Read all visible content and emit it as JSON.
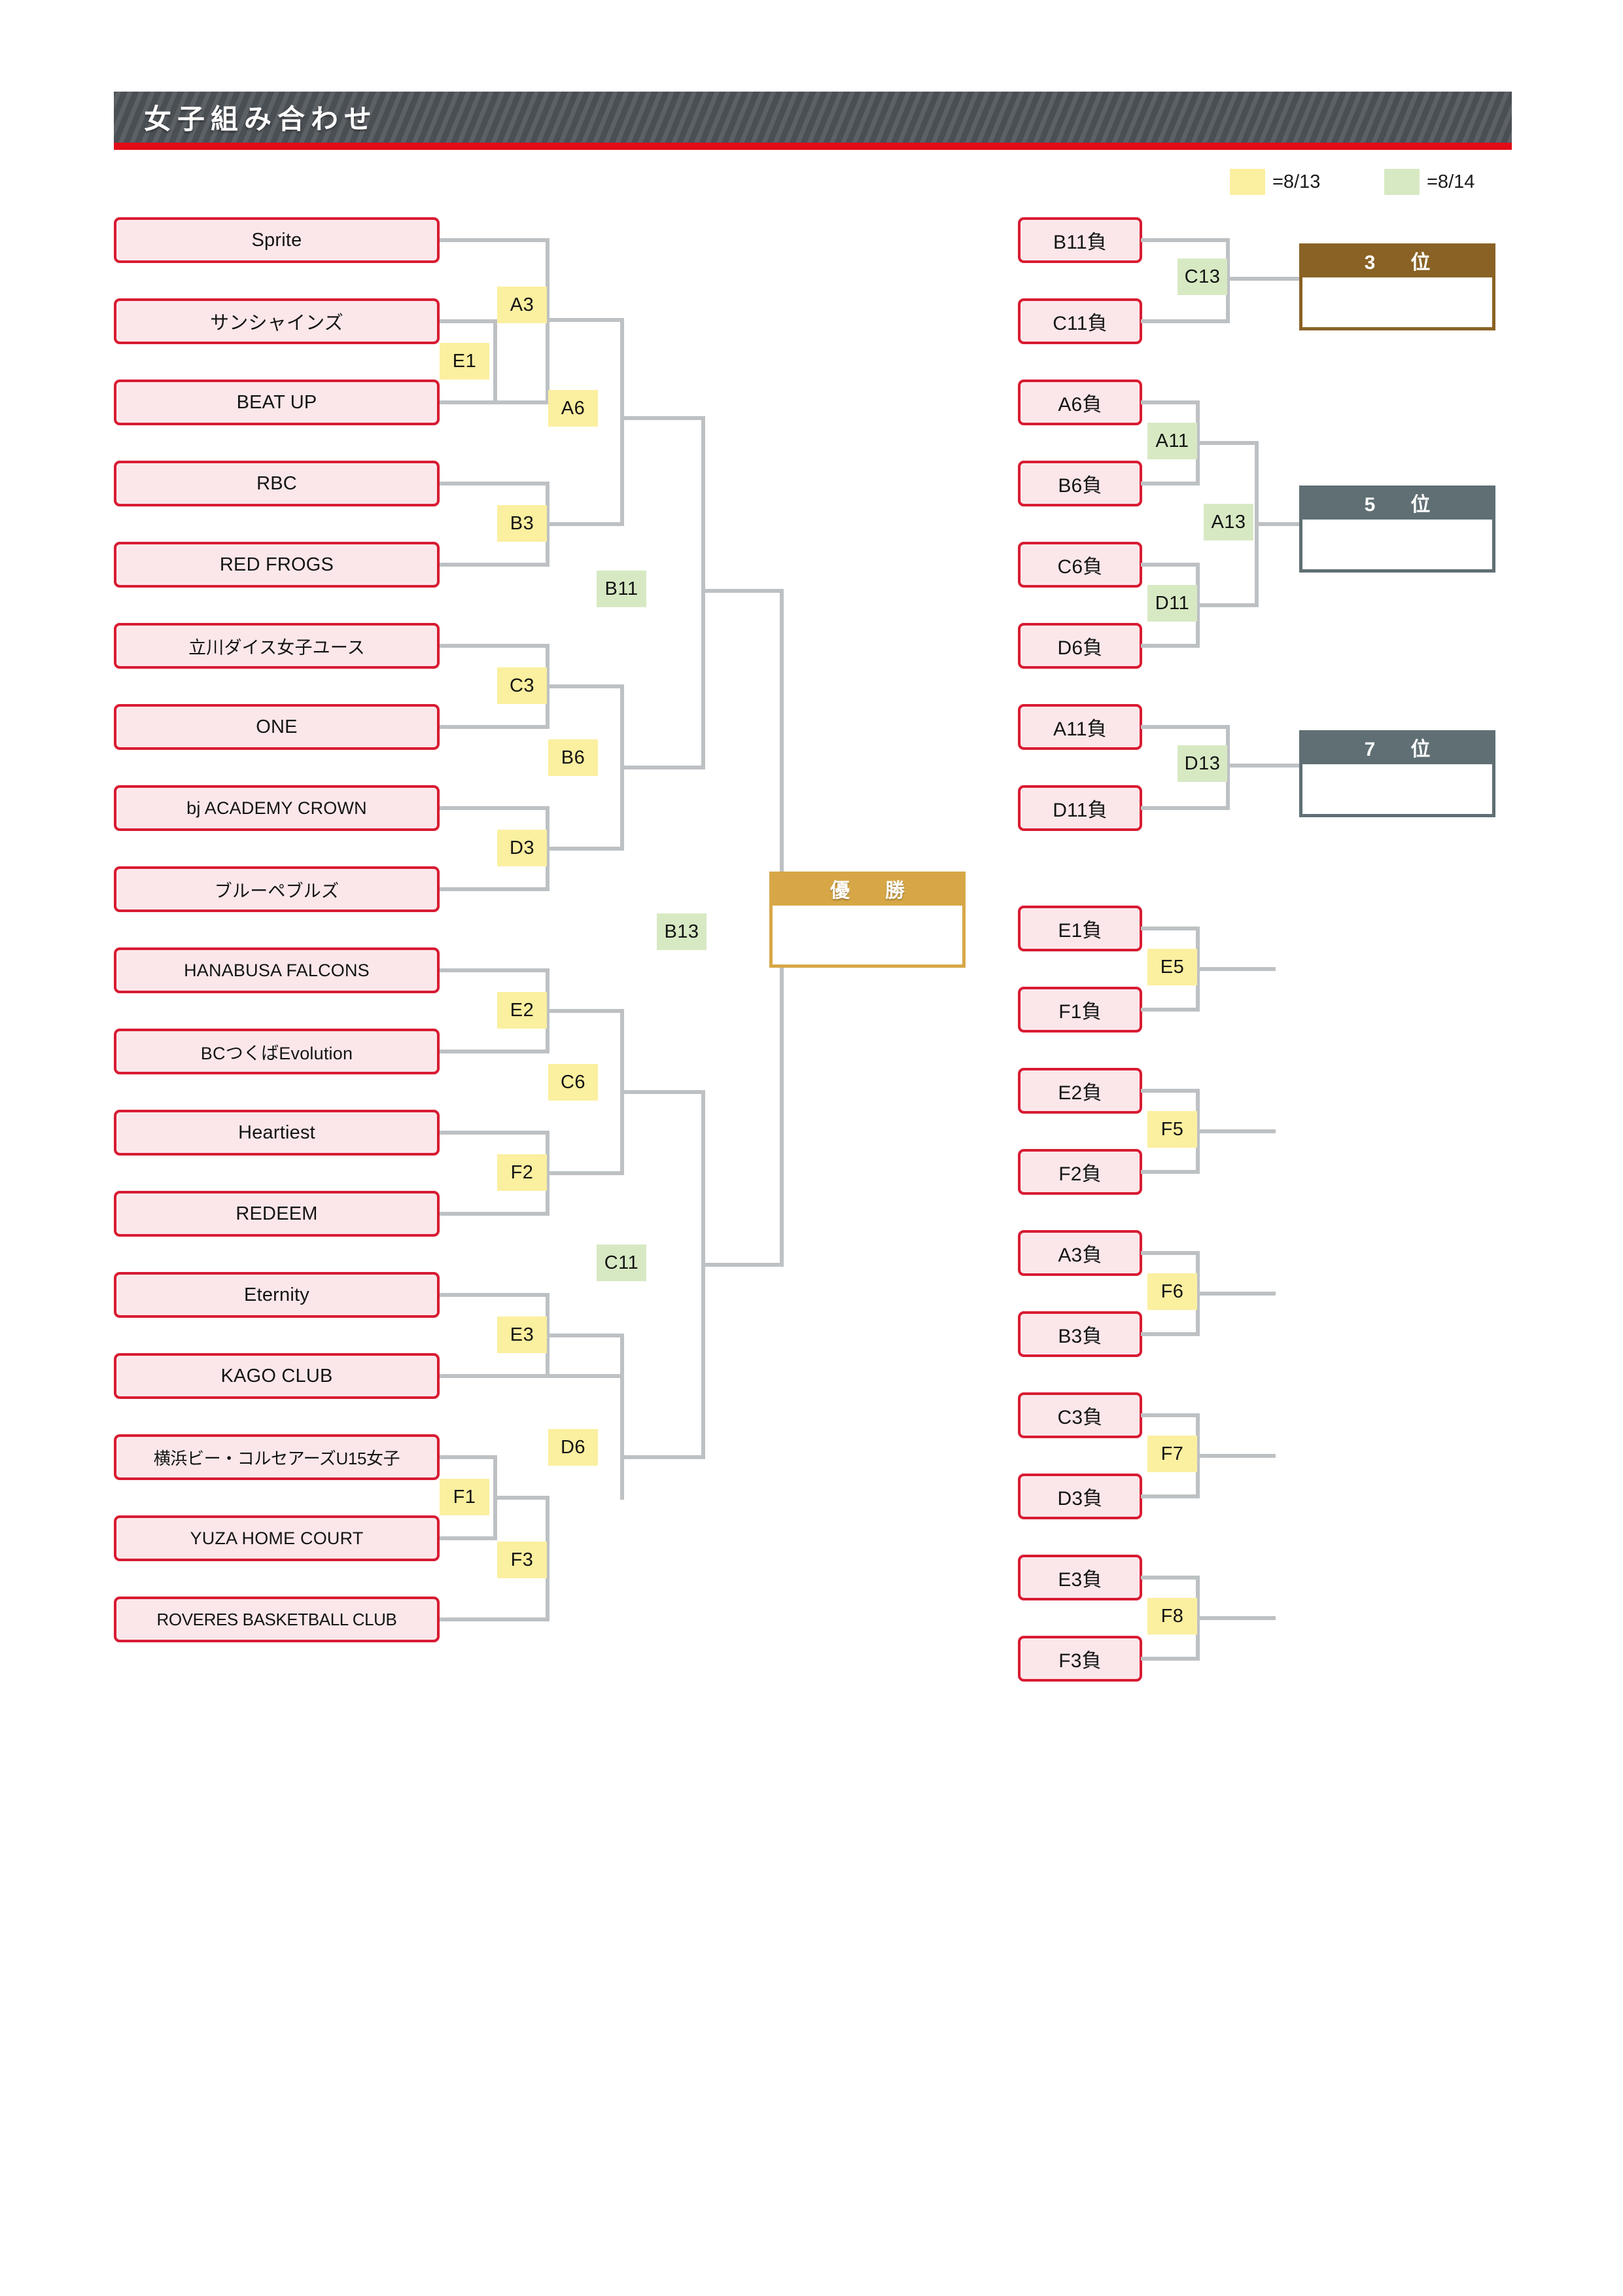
{
  "header": {
    "title": "女子組み合わせ",
    "accent_color": "#e30b18",
    "bar_color": "#4a4f54"
  },
  "legend": {
    "items": [
      {
        "swatch_color": "#fbefa0",
        "label": "=8/13"
      },
      {
        "swatch_color": "#d7e9c3",
        "label": "=8/14"
      }
    ]
  },
  "main_bracket": {
    "teams": [
      {
        "name": "Sprite"
      },
      {
        "name": "サンシャインズ"
      },
      {
        "name": "BEAT UP"
      },
      {
        "name": "RBC"
      },
      {
        "name": "RED FROGS"
      },
      {
        "name": "立川ダイス女子ユース"
      },
      {
        "name": "ONE"
      },
      {
        "name": "bj ACADEMY CROWN"
      },
      {
        "name": "ブルーペブルズ"
      },
      {
        "name": "HANABUSA FALCONS"
      },
      {
        "name": "BCつくばEvolution"
      },
      {
        "name": "Heartiest"
      },
      {
        "name": "REDEEM"
      },
      {
        "name": "Eternity"
      },
      {
        "name": "KAGO CLUB"
      },
      {
        "name": "横浜ビー・コルセアーズU15女子"
      },
      {
        "name": "YUZA HOME COURT"
      },
      {
        "name": "ROVERES BASKETBALL CLUB"
      }
    ],
    "matches": [
      {
        "code": "A3",
        "day": "8/13"
      },
      {
        "code": "E1",
        "day": "8/13"
      },
      {
        "code": "A6",
        "day": "8/13"
      },
      {
        "code": "B3",
        "day": "8/13"
      },
      {
        "code": "B11",
        "day": "8/14"
      },
      {
        "code": "C3",
        "day": "8/13"
      },
      {
        "code": "B6",
        "day": "8/13"
      },
      {
        "code": "D3",
        "day": "8/13"
      },
      {
        "code": "B13",
        "day": "8/14"
      },
      {
        "code": "E2",
        "day": "8/13"
      },
      {
        "code": "C6",
        "day": "8/13"
      },
      {
        "code": "F2",
        "day": "8/13"
      },
      {
        "code": "C11",
        "day": "8/14"
      },
      {
        "code": "E3",
        "day": "8/13"
      },
      {
        "code": "D6",
        "day": "8/13"
      },
      {
        "code": "F1",
        "day": "8/13"
      },
      {
        "code": "F3",
        "day": "8/13"
      }
    ],
    "champion": {
      "title": "優　勝",
      "winner": "",
      "header_color": "#d7a747"
    }
  },
  "placement_brackets": {
    "third": {
      "entries": [
        {
          "name": "B11負"
        },
        {
          "name": "C11負"
        }
      ],
      "match": {
        "code": "C13",
        "day": "8/14"
      },
      "result": {
        "title": "3　位",
        "winner": "",
        "header_color": "#8a6225"
      }
    },
    "fifth": {
      "entries": [
        {
          "name": "A6負"
        },
        {
          "name": "B6負"
        },
        {
          "name": "C6負"
        },
        {
          "name": "D6負"
        }
      ],
      "matches": [
        {
          "code": "A11",
          "day": "8/14"
        },
        {
          "code": "D11",
          "day": "8/14"
        },
        {
          "code": "A13",
          "day": "8/14"
        }
      ],
      "result": {
        "title": "5　位",
        "winner": "",
        "header_color": "#5f6f73"
      }
    },
    "seventh": {
      "entries": [
        {
          "name": "A11負"
        },
        {
          "name": "D11負"
        }
      ],
      "match": {
        "code": "D13",
        "day": "8/14"
      },
      "result": {
        "title": "7　位",
        "winner": "",
        "header_color": "#5f6f73"
      }
    }
  },
  "consolation_brackets": [
    {
      "entries": [
        {
          "name": "E1負"
        },
        {
          "name": "F1負"
        }
      ],
      "match": {
        "code": "E5",
        "day": "8/13"
      }
    },
    {
      "entries": [
        {
          "name": "E2負"
        },
        {
          "name": "F2負"
        }
      ],
      "match": {
        "code": "F5",
        "day": "8/13"
      }
    },
    {
      "entries": [
        {
          "name": "A3負"
        },
        {
          "name": "B3負"
        }
      ],
      "match": {
        "code": "F6",
        "day": "8/13"
      }
    },
    {
      "entries": [
        {
          "name": "C3負"
        },
        {
          "name": "D3負"
        }
      ],
      "match": {
        "code": "F7",
        "day": "8/13"
      }
    },
    {
      "entries": [
        {
          "name": "E3負"
        },
        {
          "name": "F3負"
        }
      ],
      "match": {
        "code": "F8",
        "day": "8/13"
      }
    }
  ]
}
